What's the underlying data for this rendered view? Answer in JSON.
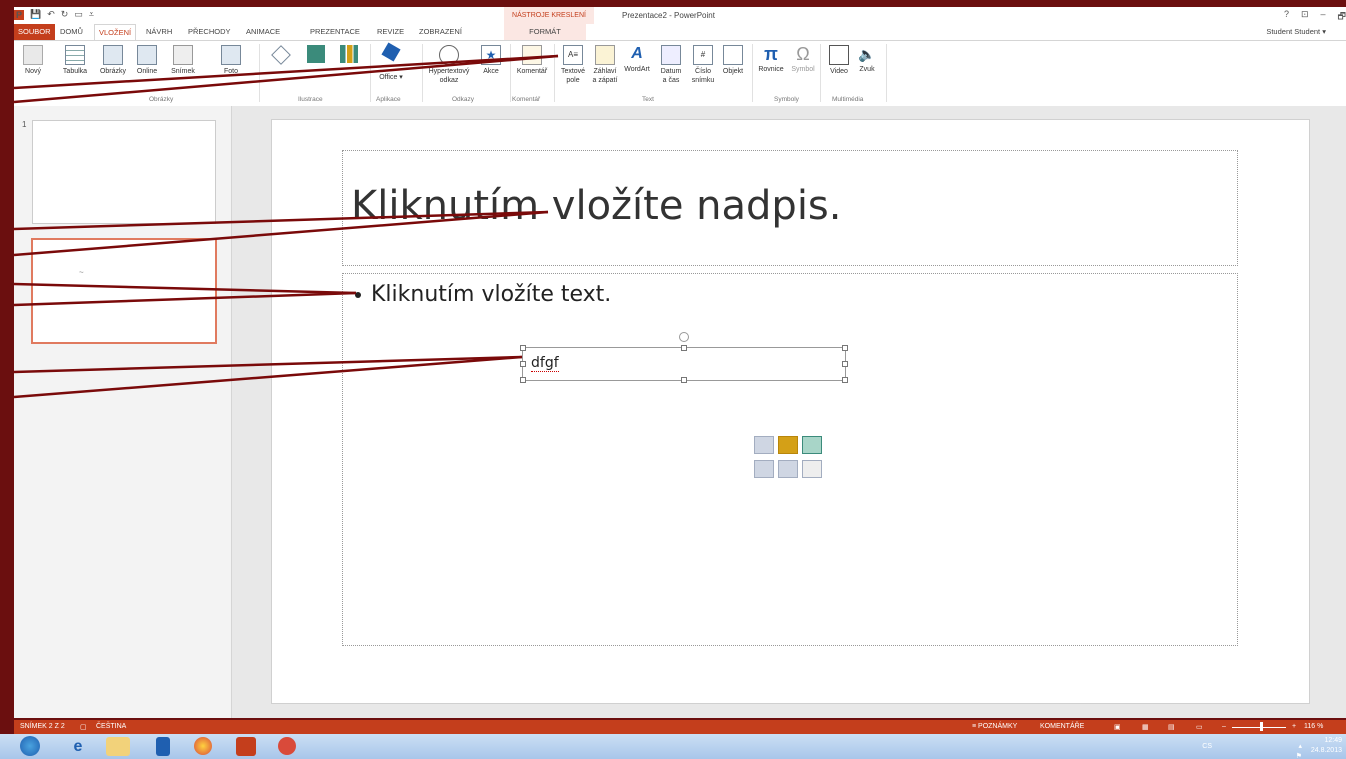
{
  "titlebar": {
    "window_title": "Prezentace2 - PowerPoint",
    "context_tab_group": "NÁSTROJE KRESLENÍ",
    "help": "?",
    "minimize": "–",
    "restore": "🗗"
  },
  "tabs": {
    "file": "SOUBOR",
    "home": "DOMŮ",
    "insert": "VLOŽENÍ",
    "design": "NÁVRH",
    "transitions": "PŘECHODY",
    "animations": "ANIMACE",
    "slideshow": "PREZENTACE",
    "review": "REVIZE",
    "view": "ZOBRAZENÍ",
    "format": "FORMÁT"
  },
  "user": "Student Student ▾",
  "ribbon": {
    "new_slide": "Nový",
    "table": "Tabulka",
    "pictures": "Obrázky",
    "online_pictures": "Online",
    "screenshot": "Snímek",
    "photo_album": "Foto",
    "office_apps": "Office ▾",
    "hyperlink_1": "Hypertextový",
    "hyperlink_2": "odkaz",
    "action": "Akce",
    "comment": "Komentář",
    "textbox_1": "Textové",
    "textbox_2": "pole",
    "header_1": "Záhlaví",
    "header_2": "a zápatí",
    "wordart": "WordArt",
    "datetime_1": "Datum",
    "datetime_2": "a čas",
    "slidenum_1": "Číslo",
    "slidenum_2": "snímku",
    "object": "Objekt",
    "equation": "Rovnice",
    "symbol": "Symbol",
    "video": "Video",
    "audio": "Zvuk",
    "groups": {
      "images": "Obrázky",
      "illustrations": "Ilustrace",
      "apps": "Aplikace",
      "links": "Odkazy",
      "comments": "Komentář",
      "text": "Text",
      "symbols": "Symboly",
      "media": "Multimédia"
    }
  },
  "thumbs": {
    "slide1_number": "1",
    "slide2_mark": "~"
  },
  "slide": {
    "title_placeholder": "Kliknutím vložíte nadpis.",
    "body_placeholder": "Kliknutím vložíte text.",
    "textbox_content": "dfgf"
  },
  "status": {
    "slide_info": "SNÍMEK 2 Z 2",
    "language": "ČEŠTINA",
    "notes": "≡ POZNÁMKY",
    "comments": "KOMENTÁŘE",
    "zoom": "116 %"
  },
  "taskbar": {
    "lang": "CS",
    "time": "12:49",
    "date": "24.8.2013"
  },
  "colors": {
    "accent": "#c43e1c",
    "frame": "#6b0f0f",
    "callout_line": "#7a0a0a"
  }
}
